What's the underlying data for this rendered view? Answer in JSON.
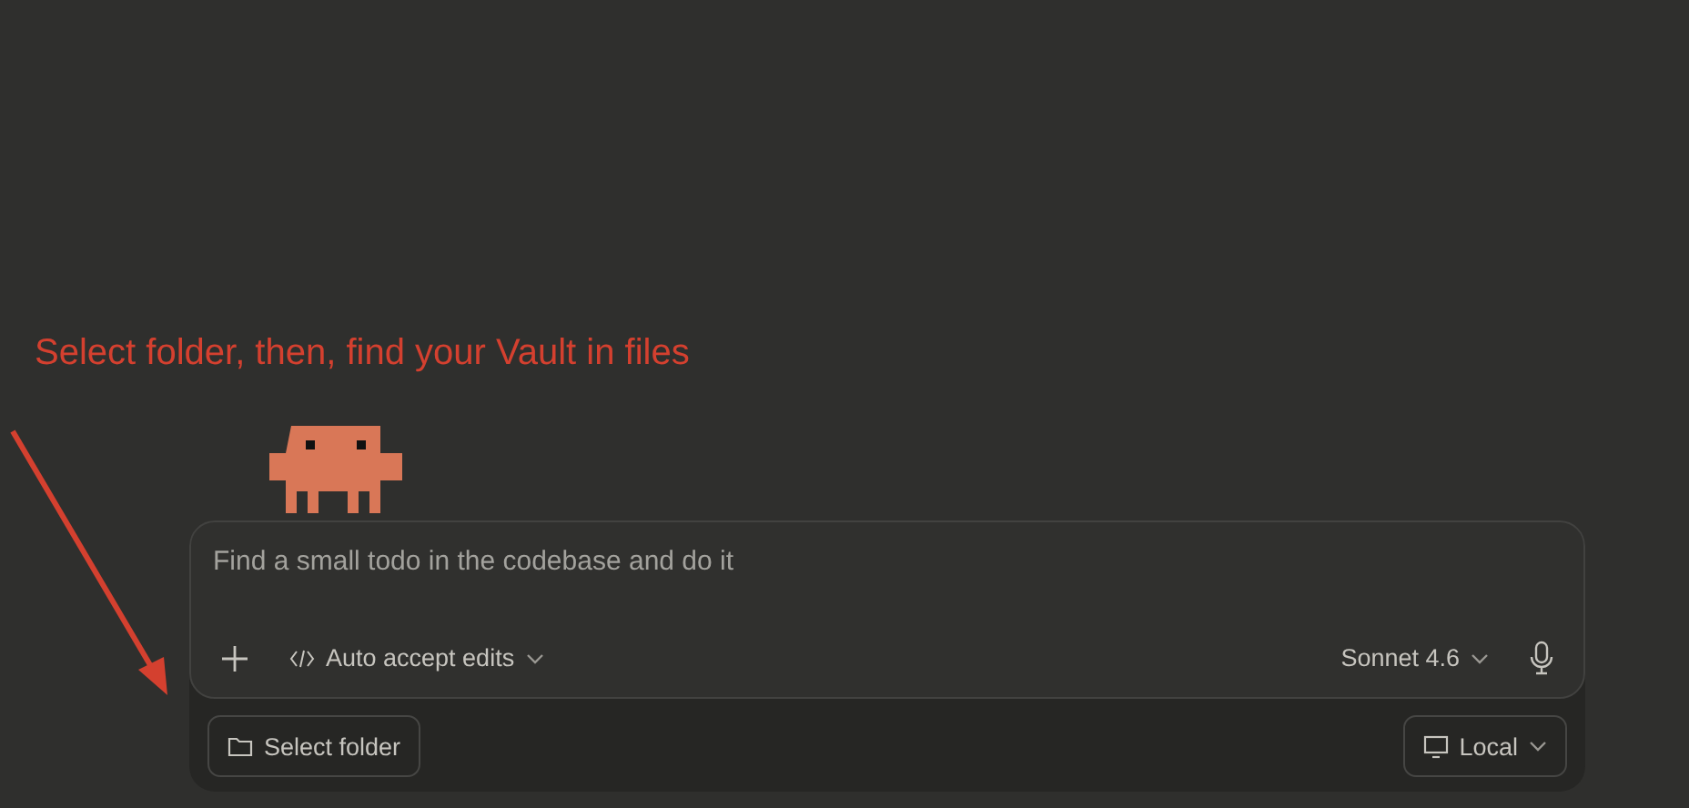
{
  "annotation": {
    "text": "Select folder, then, find your Vault in files"
  },
  "composer": {
    "placeholder": "Find a small todo in the codebase and do it",
    "mode": {
      "label": "Auto accept edits"
    },
    "model": {
      "label": "Sonnet 4.6"
    }
  },
  "tray": {
    "folder_button": {
      "label": "Select folder"
    },
    "environment": {
      "label": "Local"
    }
  }
}
